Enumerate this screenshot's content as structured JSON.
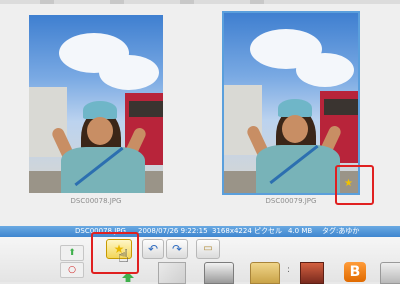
{
  "gallery": {
    "photos": [
      {
        "filename": "DSC00078.JPG",
        "selected": false,
        "starred": false
      },
      {
        "filename": "DSC00079.JPG",
        "selected": true,
        "starred": true
      }
    ]
  },
  "status_bar": {
    "filename": "DSC00078.JPG",
    "datetime": "2008/07/26 9:22:15",
    "dimensions": "3168x4224 ピクセル",
    "filesize": "4.0 MB",
    "tags": "タグ:あゆか"
  },
  "toolbar": {
    "star_glyph": "★",
    "rotate_left_glyph": "↶",
    "rotate_right_glyph": "↷",
    "tag_glyph": "▭",
    "side_up_glyph": "⬆",
    "side_circle_glyph": "○",
    "blogger_glyph": "B",
    "separator": ":"
  },
  "icons": {
    "photo_star": "★",
    "cursor": "☝"
  },
  "colors": {
    "selection_outline": "#5a9fdc",
    "status_bar": "#3f86cf",
    "highlight_box": "#e02020",
    "star": "#f2c200"
  }
}
